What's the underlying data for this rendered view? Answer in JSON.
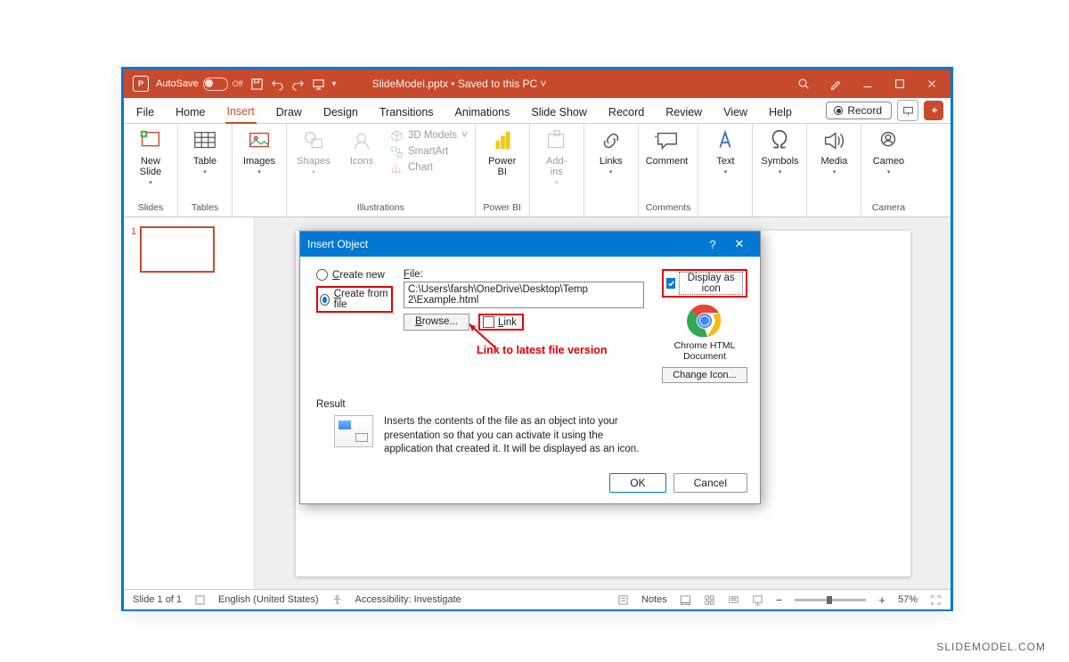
{
  "titlebar": {
    "autosave_label": "AutoSave",
    "autosave_state": "Off",
    "doc_title": "SlideModel.pptx • Saved to this PC ˅"
  },
  "tabs": {
    "file": "File",
    "home": "Home",
    "insert": "Insert",
    "draw": "Draw",
    "design": "Design",
    "transitions": "Transitions",
    "animations": "Animations",
    "slideshow": "Slide Show",
    "record": "Record",
    "review": "Review",
    "view": "View",
    "help": "Help",
    "record_btn": "Record"
  },
  "ribbon": {
    "slides": {
      "new_slide": "New\nSlide",
      "group": "Slides"
    },
    "tables": {
      "table": "Table",
      "group": "Tables"
    },
    "images": {
      "images": "Images"
    },
    "illus": {
      "shapes": "Shapes",
      "icons": "Icons",
      "models": "3D Models",
      "smartart": "SmartArt",
      "chart": "Chart",
      "group": "Illustrations"
    },
    "powerbi": {
      "btn": "Power\nBI",
      "group": "Power BI"
    },
    "addins": {
      "btn": "Add-\nins"
    },
    "links": {
      "btn": "Links"
    },
    "comments": {
      "btn": "Comment",
      "group": "Comments"
    },
    "text": {
      "btn": "Text"
    },
    "symbols": {
      "btn": "Symbols"
    },
    "media": {
      "btn": "Media"
    },
    "camera": {
      "btn": "Cameo",
      "group": "Camera"
    }
  },
  "thumb": {
    "num": "1"
  },
  "dialog": {
    "title": "Insert Object",
    "create_new": "Create new",
    "create_from_file": "Create from file",
    "file_label": "File:",
    "file_path": "C:\\Users\\farsh\\OneDrive\\Desktop\\Temp 2\\Example.html",
    "browse": "Browse...",
    "link": "Link",
    "display_as_icon": "Display as icon",
    "icon_caption": "Chrome HTML Document",
    "change_icon": "Change Icon...",
    "result_label": "Result",
    "result_text": "Inserts the contents of the file as an object into your presentation so that you can activate it using the application that created it. It will be displayed as an icon.",
    "ok": "OK",
    "cancel": "Cancel",
    "annotation": "Link to latest file version"
  },
  "status": {
    "slide": "Slide 1 of 1",
    "lang": "English (United States)",
    "access": "Accessibility: Investigate",
    "notes": "Notes",
    "zoom": "57%"
  },
  "brand": "SLIDEMODEL.COM"
}
